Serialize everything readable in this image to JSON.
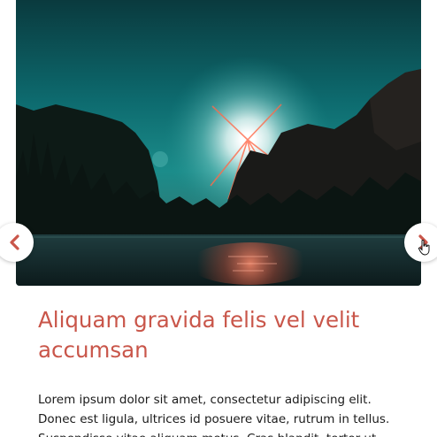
{
  "slider": {
    "image_icon": "sunburst-valley-landscape-photo",
    "prev_icon": "chevron-left-icon",
    "next_icon": "chevron-right-icon",
    "arrow_color": "#c9564a"
  },
  "article": {
    "title": "Aliquam gravida felis vel velit accumsan",
    "body": "Lorem ipsum dolor sit amet, consectetur adipiscing elit. Donec est ligula, ultrices id posuere vitae, rutrum in tellus. Suspendisse vitae aliquam metus. Cras blandit, tortor ut",
    "title_color": "#c9564a"
  }
}
